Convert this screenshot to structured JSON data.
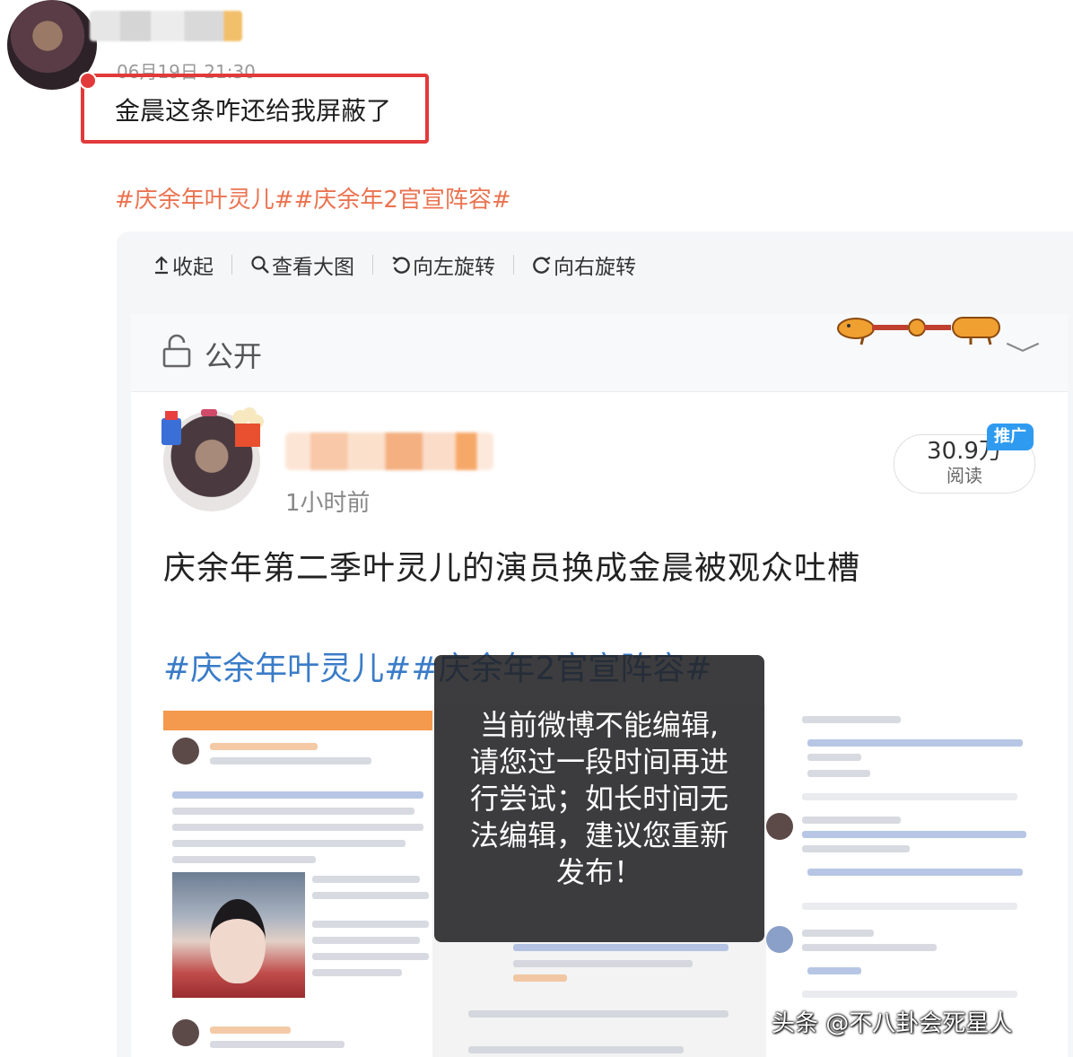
{
  "top_post": {
    "time": "06月19日 21:30",
    "text": "金晨这条咋还给我屏蔽了",
    "hashtags": "#庆余年叶灵儿##庆余年2官宣阵容#"
  },
  "toolbar": {
    "collapse": {
      "icon": "upload-arrow-icon",
      "label": "收起"
    },
    "view_large": {
      "icon": "search-icon",
      "label": "查看大图"
    },
    "rotate_left": {
      "icon": "rotate-left-icon",
      "label": "向左旋转"
    },
    "rotate_right": {
      "icon": "rotate-right-icon",
      "label": "向右旋转"
    }
  },
  "embedded": {
    "visibility": {
      "icon": "unlock-icon",
      "label": "公开"
    },
    "post_time": "1小时前",
    "reads_count": "30.9万",
    "reads_label": "阅读",
    "promo_badge": "推广",
    "title": "庆余年第二季叶灵儿的演员换成金晨被观众吐槽",
    "hashtags": "#庆余年叶灵儿##庆余年2官宣阵容#"
  },
  "toast": {
    "lines": [
      "当前微博不能编辑,",
      "请您过一段时间再进",
      "行尝试；如长时间无",
      "法编辑，建议您重新",
      "发布！"
    ]
  },
  "watermark": "头条 @不八卦会死星人",
  "colors": {
    "accent_red": "#e23a3a",
    "hashtag_orange": "#eb7350",
    "hashtag_blue": "#3a7cc8",
    "promo_blue": "#2f9bf0"
  }
}
